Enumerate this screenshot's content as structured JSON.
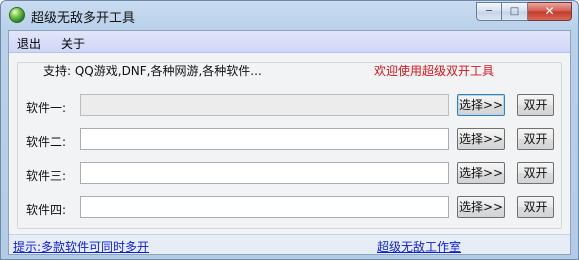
{
  "window": {
    "title": "超级无敌多开工具"
  },
  "titlebar_controls": {
    "minimize": "─",
    "maximize": "□",
    "close": "✕"
  },
  "menu": {
    "items": [
      "退出",
      "关于"
    ]
  },
  "header": {
    "support": "支持: QQ游戏,DNF,各种网游,各种软件...",
    "welcome": "欢迎使用超级双开工具"
  },
  "rows": [
    {
      "label": "软件一:",
      "value": "",
      "browse": "选择>>",
      "start": "双开",
      "disabled": true
    },
    {
      "label": "软件二:",
      "value": "",
      "browse": "选择>>",
      "start": "双开",
      "disabled": false
    },
    {
      "label": "软件三:",
      "value": "",
      "browse": "选择>>",
      "start": "双开",
      "disabled": false
    },
    {
      "label": "软件四:",
      "value": "",
      "browse": "选择>>",
      "start": "双开",
      "disabled": false
    }
  ],
  "status": {
    "hint": "提示:多款软件可同时多开",
    "studio": "超级无敌工作室"
  },
  "colors": {
    "title_frame": "#b9d0ea",
    "menu_bar": "#d6dcf8",
    "welcome_red": "#d6151c",
    "link_blue": "#0b1fd6"
  },
  "icons": {
    "app": "green-globe-icon",
    "minimize": "minimize-icon",
    "maximize": "maximize-icon",
    "close": "close-icon"
  }
}
